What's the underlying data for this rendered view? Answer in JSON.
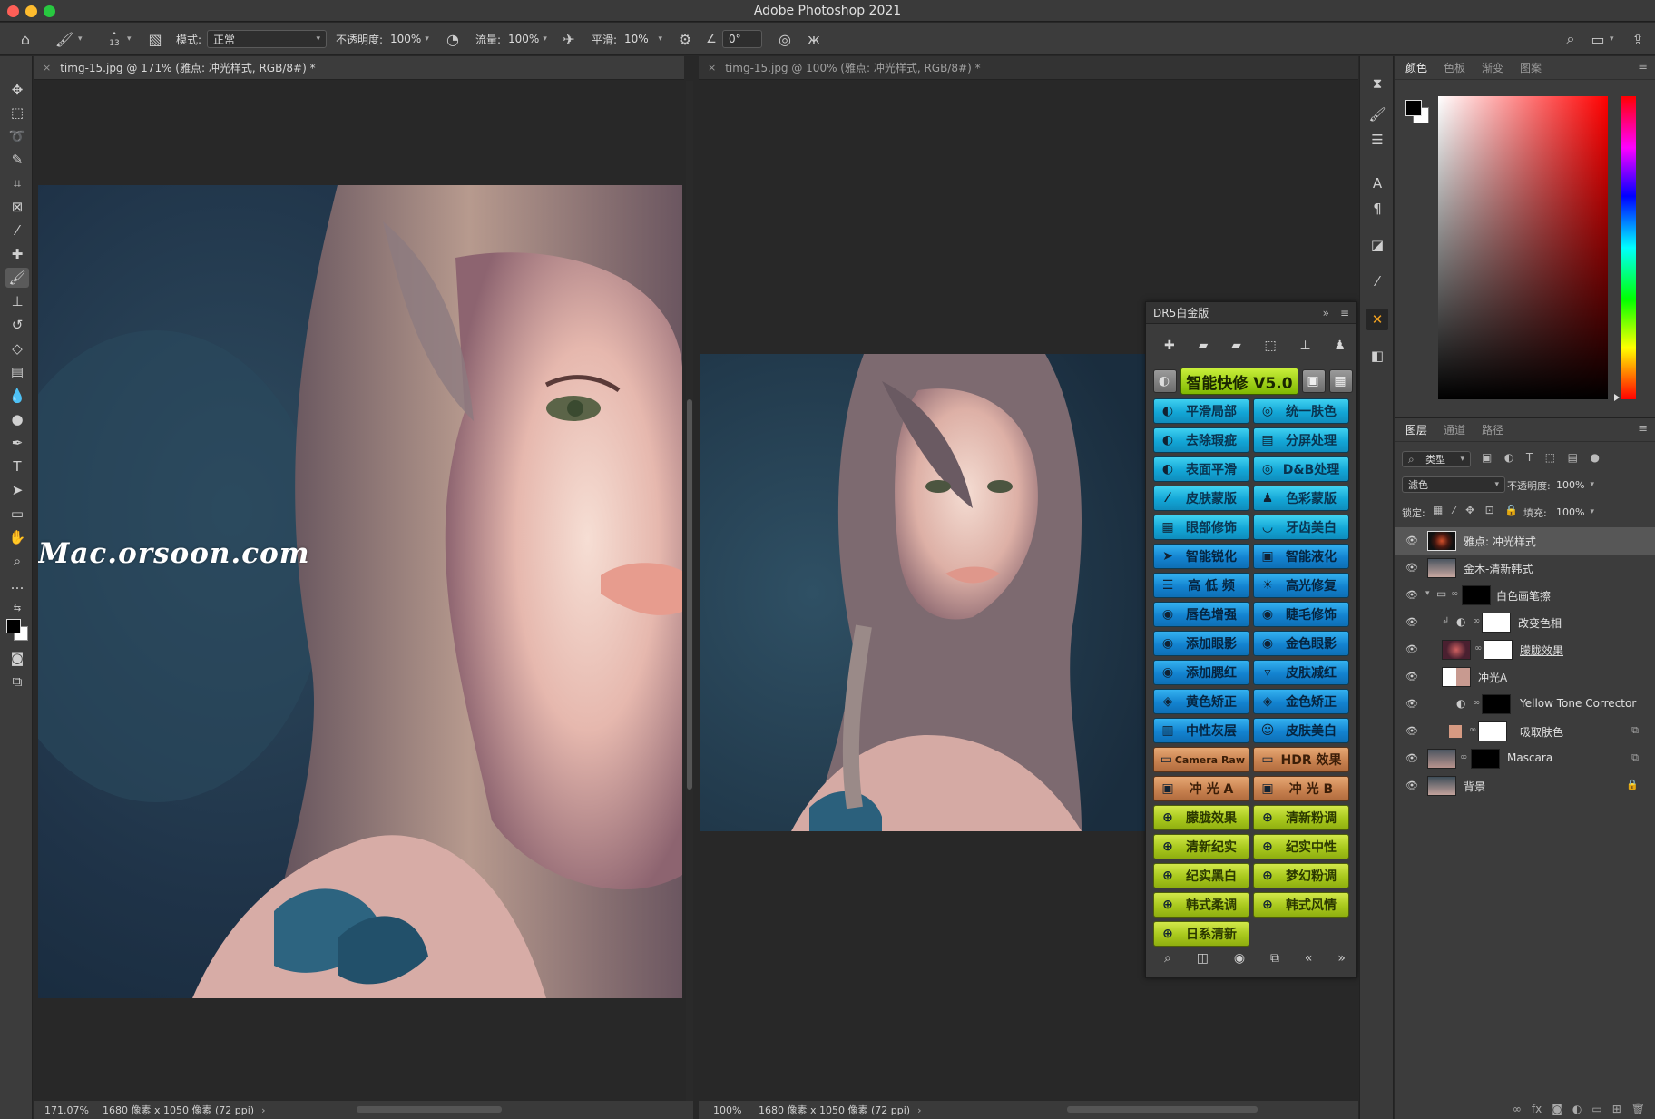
{
  "window": {
    "title": "Adobe Photoshop 2021"
  },
  "options_bar": {
    "brush_size": "13",
    "mode_label": "模式:",
    "mode_value": "正常",
    "opacity_label": "不透明度:",
    "opacity_value": "100%",
    "flow_label": "流量:",
    "flow_value": "100%",
    "smooth_label": "平滑:",
    "smooth_value": "10%",
    "angle_value": "0°"
  },
  "documents": [
    {
      "tab_title": "timg-15.jpg @ 171% (雅点: 冲光样式, RGB/8#) *",
      "zoom": "171.07%",
      "info": "1680 像素 x 1050 像素 (72 ppi)",
      "watermark": "Mac.orsoon.com",
      "active": true
    },
    {
      "tab_title": "timg-15.jpg @ 100% (雅点: 冲光样式, RGB/8#) *",
      "zoom": "100%",
      "info": "1680 像素 x 1050 像素 (72 ppi)",
      "active": false
    }
  ],
  "color_panel": {
    "tabs": [
      "颜色",
      "色板",
      "渐变",
      "图案"
    ],
    "active_tab": "颜色"
  },
  "layers_panel": {
    "tabs": [
      "图层",
      "通道",
      "路径"
    ],
    "filter_label": "类型",
    "blend_mode": "滤色",
    "opacity_label": "不透明度:",
    "opacity_value": "100%",
    "lock_label": "锁定:",
    "fill_label": "填充:",
    "fill_value": "100%",
    "layers": [
      {
        "name": "雅点: 冲光样式",
        "selected": true
      },
      {
        "name": "金木-清新韩式"
      },
      {
        "name": "白色画笔擦"
      },
      {
        "name": "改变色相"
      },
      {
        "name": "朦胧效果"
      },
      {
        "name": "冲光A"
      },
      {
        "name": "Yellow Tone Corrector"
      },
      {
        "name": "吸取肤色"
      },
      {
        "name": "Mascara"
      },
      {
        "name": "背景"
      }
    ]
  },
  "dr5_panel": {
    "title": "DR5白金版",
    "banner": "智能快修 V5.0",
    "buttons": [
      [
        "平滑局部",
        "统一肤色"
      ],
      [
        "去除瑕疵",
        "分屏处理"
      ],
      [
        "表面平滑",
        "D&B处理"
      ],
      [
        "皮肤蒙版",
        "色彩蒙版"
      ],
      [
        "眼部修饰",
        "牙齿美白"
      ],
      [
        "智能锐化",
        "智能液化"
      ],
      [
        "高 低 频",
        "高光修复"
      ],
      [
        "唇色增强",
        "睫毛修饰"
      ],
      [
        "添加眼影",
        "金色眼影"
      ],
      [
        "添加腮红",
        "皮肤减红"
      ],
      [
        "黄色矫正",
        "金色矫正"
      ],
      [
        "中性灰层",
        "皮肤美白"
      ],
      [
        "Camera Raw",
        "HDR 效果"
      ],
      [
        "冲 光 A",
        "冲 光 B"
      ],
      [
        "朦胧效果",
        "清新粉调"
      ],
      [
        "清新纪实",
        "纪实中性"
      ],
      [
        "纪实黑白",
        "梦幻粉调"
      ],
      [
        "韩式柔调",
        "韩式风情"
      ],
      [
        "日系清新"
      ]
    ]
  },
  "colors": {
    "foreground": "#000000",
    "background": "#ffffff"
  }
}
